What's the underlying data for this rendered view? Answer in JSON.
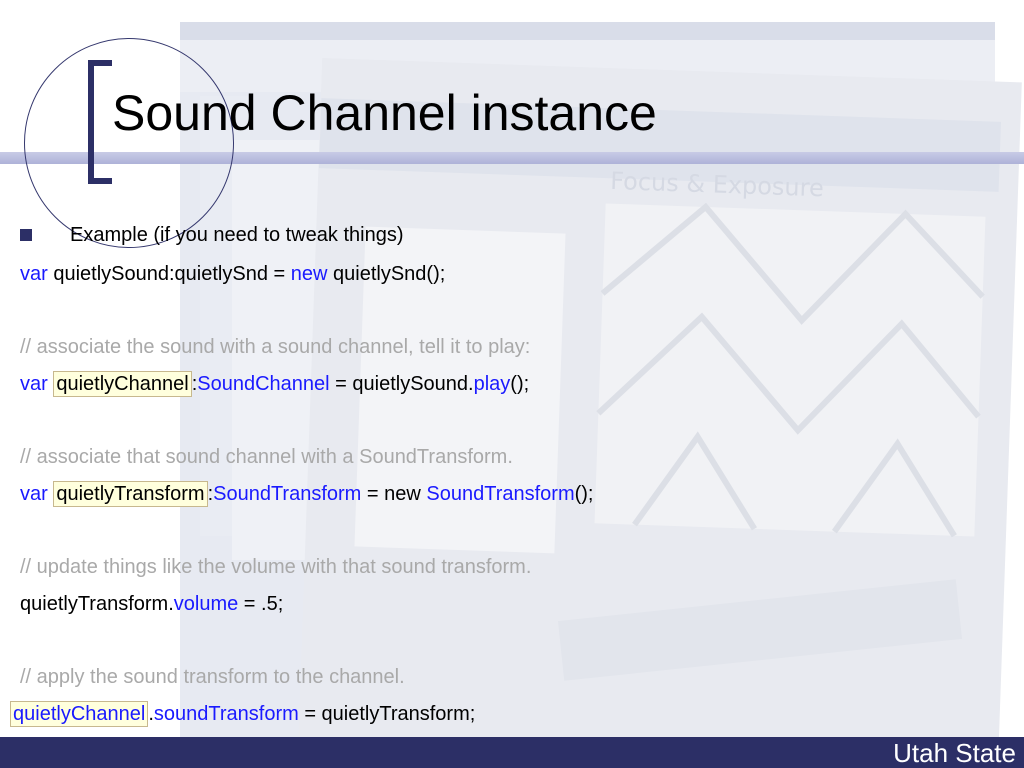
{
  "title": "Sound Channel instance",
  "bullet": "Example (if you need to tweak things)",
  "code": {
    "l1": {
      "a": "var",
      "b": " quietlySound:quietlySnd = ",
      "c": "new",
      "d": " quietlySnd();"
    },
    "l2": "//  associate the sound with a sound channel, tell it to play:",
    "l3": {
      "a": "var",
      "b": "quietlyChannel",
      "c": ":",
      "d": "SoundChannel",
      "e": " = quietlySound.",
      "f": "play",
      "g": "();"
    },
    "l4": "// associate that sound channel with a SoundTransform.",
    "l5": {
      "a": "var",
      "b": "quietlyTransform",
      "c": ":",
      "d": "SoundTransform",
      "e": " = new ",
      "f": "SoundTransform",
      "g": "();"
    },
    "l6": "// update things like the volume with that sound transform.",
    "l7": {
      "a": "quietlyTransform.",
      "b": "volume",
      "c": " = .5;"
    },
    "l8": "// apply the sound transform to the channel.",
    "l9": {
      "a": "quietlyChannel",
      "b": ".",
      "c": "soundTransform",
      "d": " = quietlyTransform;"
    }
  },
  "footer": "Utah State",
  "bg_labels": {
    "window": "Focus & Exposure"
  },
  "colors": {
    "keyword": "#1a1aff",
    "comment": "#a9a9a9",
    "highlight": "#ffffdd",
    "footer": "#2c2f66"
  }
}
